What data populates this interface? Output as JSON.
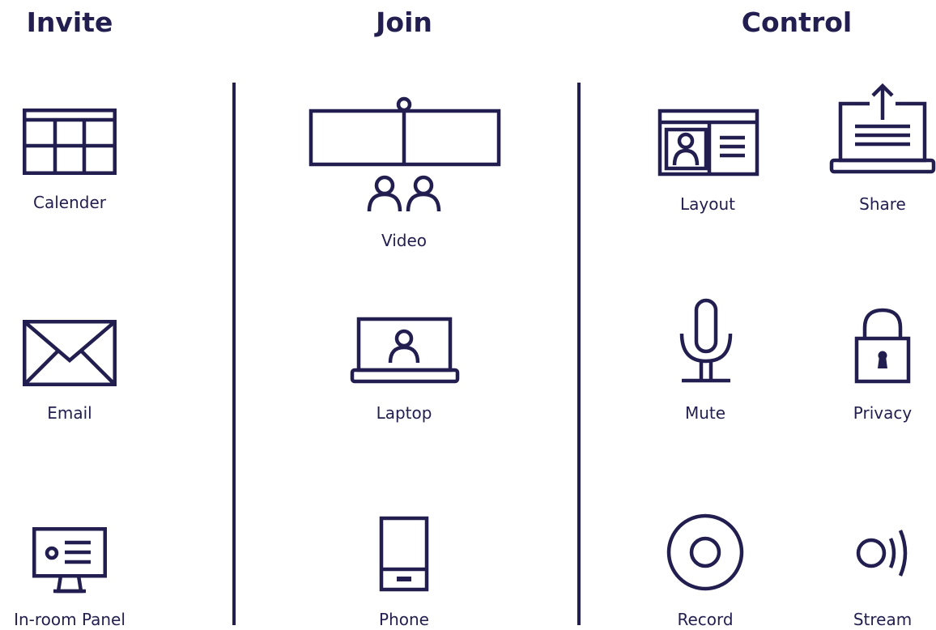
{
  "colors": {
    "ink": "#221e4f",
    "background": "#ffffff"
  },
  "sections": {
    "invite": {
      "title": "Invite",
      "items": {
        "calendar": {
          "label": "Calender",
          "icon": "calendar-icon"
        },
        "email": {
          "label": "Email",
          "icon": "envelope-icon"
        },
        "panel": {
          "label": "In-room Panel",
          "icon": "room-panel-icon"
        }
      }
    },
    "join": {
      "title": "Join",
      "items": {
        "video": {
          "label": "Video",
          "icon": "video-bar-icon"
        },
        "laptop": {
          "label": "Laptop",
          "icon": "laptop-icon"
        },
        "phone": {
          "label": "Phone",
          "icon": "phone-icon"
        }
      }
    },
    "control": {
      "title": "Control",
      "items": {
        "layout": {
          "label": "Layout",
          "icon": "layout-icon"
        },
        "share": {
          "label": "Share",
          "icon": "share-icon"
        },
        "mute": {
          "label": "Mute",
          "icon": "microphone-icon"
        },
        "privacy": {
          "label": "Privacy",
          "icon": "lock-icon"
        },
        "record": {
          "label": "Record",
          "icon": "record-icon"
        },
        "stream": {
          "label": "Stream",
          "icon": "stream-icon"
        }
      }
    }
  }
}
